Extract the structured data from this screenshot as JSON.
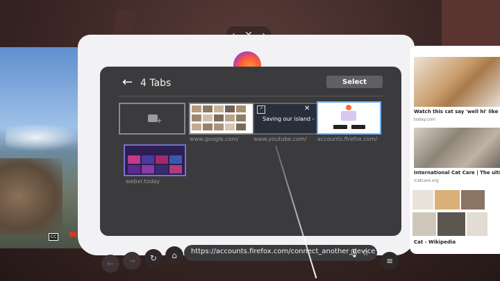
{
  "window_controls": {
    "prev": "‹",
    "close": "✕",
    "next": "›"
  },
  "tabs_panel": {
    "title": "4 Tabs",
    "back_icon": "arrow-left-icon",
    "select_label": "Select",
    "tabs": [
      {
        "url": "www.google.com/"
      },
      {
        "url": "www.youtube.com/",
        "thumbnail_text": "Saving our island -"
      },
      {
        "url": "accounts.firefox.com/"
      },
      {
        "url": "webxr.today"
      }
    ]
  },
  "right_panel": {
    "items": [
      {
        "caption": "Watch this cat say 'well hi' like a",
        "source": "today.com"
      },
      {
        "caption": "International Cat Care | The ultimat",
        "source": "icatcare.org"
      },
      {
        "caption": "Cat - Wikipedia",
        "source": ""
      }
    ]
  },
  "left_panel": {
    "cc_label": "CC"
  },
  "toolbar": {
    "url": "https://accounts.firefox.com/connect_another_device",
    "back_icon": "arrow-left-icon",
    "forward_icon": "arrow-right-icon",
    "reload_icon": "reload-icon",
    "home_icon": "home-icon",
    "mic_icon": "microphone-icon",
    "bookmark_icon": "star-icon",
    "menu_icon": "hamburger-menu-icon"
  },
  "colors": {
    "accent_blue": "#6fb1ff",
    "panel_dark": "#3b3b3d",
    "panel_light": "#f2f1f3"
  }
}
